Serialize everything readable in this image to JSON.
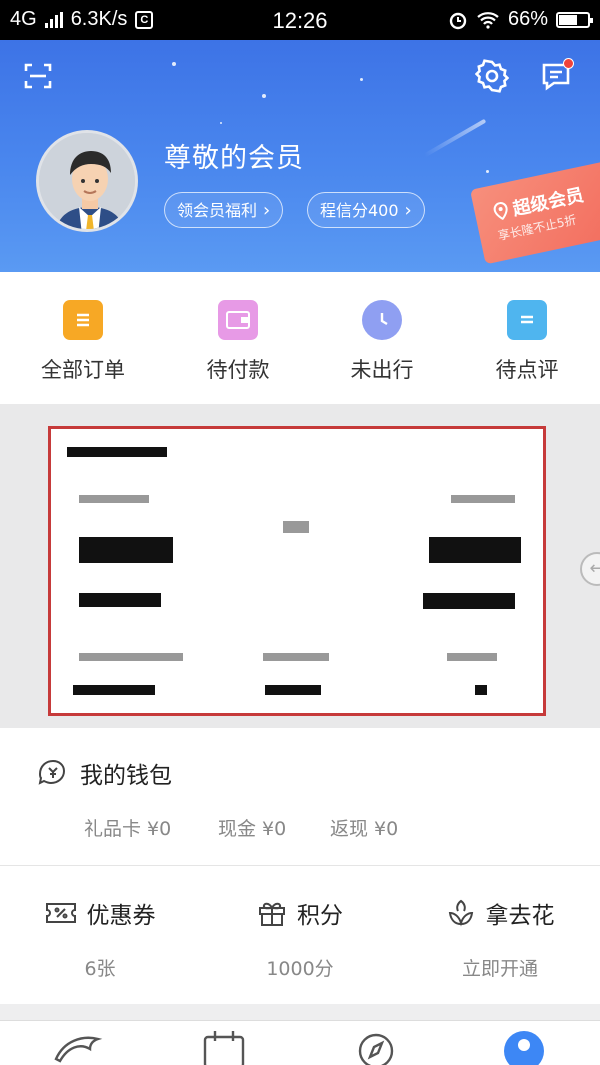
{
  "status_bar": {
    "network": "4G",
    "speed": "6.3K/s",
    "time": "12:26",
    "battery": "66%"
  },
  "header": {
    "member_name": "尊敬的会员",
    "benefits_pill": "领会员福利",
    "credit_pill": "程信分400",
    "super_title": "超级会员",
    "super_subtitle": "享长隆不止5折",
    "has_notification_dot": true
  },
  "orders": [
    {
      "label": "全部订单",
      "icon": "document-icon",
      "color": "#f7a825"
    },
    {
      "label": "待付款",
      "icon": "wallet-icon",
      "color": "#e79ae6"
    },
    {
      "label": "未出行",
      "icon": "clock-icon",
      "color": "#8f9ff2"
    },
    {
      "label": "待点评",
      "icon": "comment-icon",
      "color": "#4fb5ef"
    }
  ],
  "wallet": {
    "title": "我的钱包",
    "gift_card": "礼品卡 ¥0",
    "cash": "现金 ¥0",
    "cashback": "返现 ¥0"
  },
  "benefits": [
    {
      "label": "优惠券",
      "value": "6张",
      "icon": "coupon-icon"
    },
    {
      "label": "积分",
      "value": "1000分",
      "icon": "gift-icon"
    },
    {
      "label": "拿去花",
      "value": "立即开通",
      "icon": "flower-icon"
    }
  ],
  "bottom_nav": [
    {
      "icon": "dolphin-icon"
    },
    {
      "icon": "calendar-icon"
    },
    {
      "icon": "compass-icon"
    },
    {
      "icon": "profile-icon",
      "active": true
    }
  ],
  "colors": {
    "header_blue": "#4a87ee",
    "accent": "#3d87f5",
    "ticket_border": "#c63a3a",
    "notification_dot": "#f0433a"
  }
}
